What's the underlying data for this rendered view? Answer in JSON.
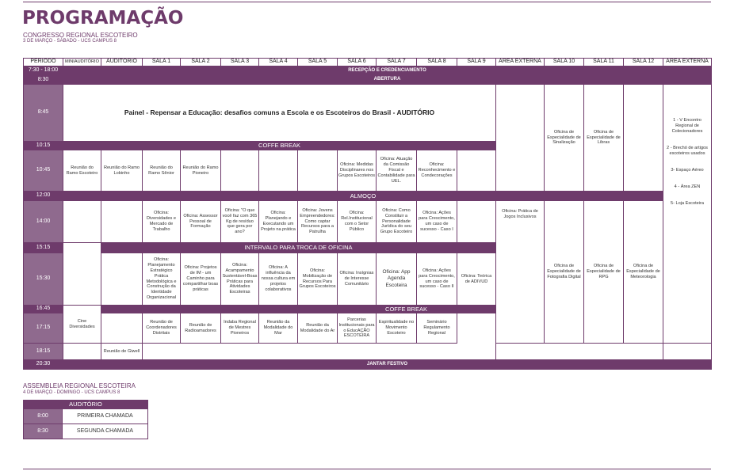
{
  "header": {
    "title": "PROGRAMAÇÃO",
    "subtitle": "CONGRESSO REGIONAL ESCOTEIRO",
    "date_line": "3 DE MARÇO - SÁBADO - UCS CAMPUS 8"
  },
  "columns": [
    "PERÍODO",
    "MINIAUDITÓRIO",
    "AUDITÓRIO",
    "SALA 1",
    "SALA 2",
    "SALA 3",
    "SALA 4",
    "SALA 5",
    "SALA 6",
    "SALA 7",
    "SALA 8",
    "SALA 9",
    "ÁREA EXTERNA",
    "SALA 10",
    "SALA 11",
    "SALA 12",
    "ÁREA EXTERNA"
  ],
  "times": {
    "t0730": "7:30 - 18:00",
    "t0830": "8:30",
    "t0845": "8:45",
    "t1015": "10:15",
    "t1045": "10:45",
    "t1200": "12:00",
    "t1400": "14:00",
    "t1515": "15:15",
    "t1530": "15:30",
    "t1645": "16:45",
    "t1715": "17:15",
    "t1815": "18:15",
    "t2030": "20:30"
  },
  "bars": {
    "recepcao": "RECEPÇÃO E CREDENCIAMENTO",
    "abertura": "ABERTURA",
    "coffee1": "COFFE BREAK",
    "almoco": "ALMOÇO",
    "intervalo": "INTERVALO PARA TROCA DE OFICINA",
    "coffee2": "COFFE BREAK",
    "jantar": "JANTAR FESTIVO"
  },
  "cells": {
    "painel": "Painel - Repensar a Educação: desafios comuns a Escola e os Escoteiros do Brasil - AUDITÓRIO",
    "s10_sinal": "Oficina de Especialidade de Sinalização",
    "s11_libras": "Oficina de Especialidade de Libras",
    "ext_side": "1 - V Encontro Regional de Colecionadores\n\n\n2 - Brechó de artigos escoteiros usados\n\n\n3- Espaço Aéreo\n\n\n4 - Área ZEN\n\n\n5- Loja Escoteira",
    "mini_1045": "Reunião do Ramo Escoteiro",
    "aud_1045": "Reunião do Ramo Lobinho",
    "s1_1045": "Reunião do Ramo Sênior",
    "s2_1045": "Reunião do Ramo Pioneiro",
    "s6_1045": "Oficina: Medidas Disciplinares nos Grupos Escoteiros",
    "s7_1045": "Oficina: Atuação da Comissão Fiscal e Contabilidade para UEL.",
    "s8_1045": "Oficina: Reconhecimento e Condecorações",
    "s1_1400": "Oficina: Diversidades e Mercado de Trabalho",
    "s2_1400": "Oficina: Assessor Pessoal de Formação",
    "s3_1400": "Oficina: \"O que você faz com 365 Kg de resíduo que gera por ano?",
    "s4_1400": "Oficina: Planejando e Executando um Projeto na prática",
    "s5_1400": "Oficina: Jovens Empreendedores: Como captar Recursos para a Patrulha",
    "s6_1400": "Oficina: Rel.Institucional com o Setor Público",
    "s7_1400": "Oficina: Como Constituir a Personalidade Jurídica do seu Grupo Escoteiro",
    "s8_1400": "Oficina: Ações para Crescimento, um caso de sucesso - Caso I",
    "ext_1400": "Oficina: Prática de Jogos Inclusivos",
    "s10_foto": "Oficina de Especialidade de Fotografia Digital",
    "s11_rpg": "Oficina de Especialidade de RPG",
    "s12_meteo": "Oficina de Especialidade de Meteorologia",
    "s1_1530": "Oficina: Planejamento Estratégico Prática Metodológica e Construção da Identidade Organizacional",
    "s2_1530": "Oficina: Projetos de IM - um Caminho para compartilhar boas práticas",
    "s3_1530": "Oficina: Acampamento Sustentável-Boas Práticas para Atividades Escoteiras",
    "s4_1530": "Oficina: A influência da nossa cultura em projetos colaborativos",
    "s5_1530": "Oficina: Mobilização de Recursos Para Grupos Escoteiros",
    "s6_1530": "Oficina: Insígnias de Interesse Comunitário",
    "s7_1530": "Oficina: App Agenda Escoteira",
    "s8_1530": "Oficina: Ações para Crescimento, um caso de sucesso - Caso II",
    "s9_1530": "Oficina: Teórica de ADIVUD",
    "cine": "Cine Diversidades",
    "s1_1715": "Reunião de Coordenadores Distritais",
    "s2_1715": "Reunião de Radioamadores",
    "s3_1715": "Indaba Regional de Mestres Pioneiros",
    "s4_1715": "Reunião da Modalidade do Mar",
    "s5_1715": "Reunião da Modalidade do Ar",
    "s6_1715": "Parcerias Institucionais para o EducAÇÃO ESCOTEIRA",
    "s7_1715": "Espiritualidade no Movimento Escoteiro",
    "s8_1715": "Seminário Regulamento Regional",
    "aud_1815": "Reunião de Giwell"
  },
  "assembly": {
    "title": "ASSEMBLEIA REGIONAL ESCOTEIRA",
    "date_line": "4 DE MARÇO - DOMINGO - UCS CAMPUS 8",
    "header": "AUDITÓRIO",
    "rows": [
      {
        "time": "8:00",
        "label": "PRIMEIRA CHAMADA"
      },
      {
        "time": "8:30",
        "label": "SEGUNDA CHAMADA"
      }
    ]
  },
  "colors": {
    "accent": "#6e3b6b",
    "time_cell": "#8f6a8e"
  }
}
